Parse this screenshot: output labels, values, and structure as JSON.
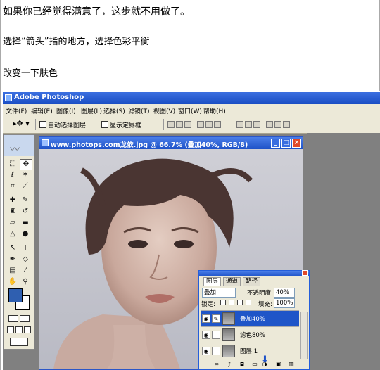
{
  "article": {
    "line1": "如果你已经觉得满意了，这步就不用做了。",
    "line2": "选择“箭头”指的地方，选择色彩平衡",
    "line3": "改变一下肤色"
  },
  "photoshop": {
    "title": "Adobe Photoshop",
    "menu": [
      "文件(F)",
      "编辑(E)",
      "图像(I)",
      "图层(L)",
      "选择(S)",
      "滤镜(T)",
      "视图(V)",
      "窗口(W)",
      "帮助(H)"
    ],
    "options": {
      "auto_select": "自动选择图层",
      "show_bounds": "显示定界框"
    },
    "document": {
      "title": "www.photops.com龙依.jpg @ 66.7% (叠加40%, RGB/8)"
    },
    "layers_panel": {
      "tabs": [
        "图层",
        "通道",
        "路径"
      ],
      "blend_mode": "叠加",
      "opacity_label": "不透明度:",
      "opacity_value": "40%",
      "lock_label": "锁定:",
      "fill_label": "填充:",
      "fill_value": "100%",
      "layers": [
        {
          "name": "叠加40%",
          "selected": true
        },
        {
          "name": "滤色80%",
          "selected": false
        },
        {
          "name": "图层 1",
          "selected": false
        }
      ]
    },
    "colors": {
      "foreground": "#2f5fb0",
      "background": "#ffffff",
      "title_bar": "#1e52c8"
    }
  }
}
